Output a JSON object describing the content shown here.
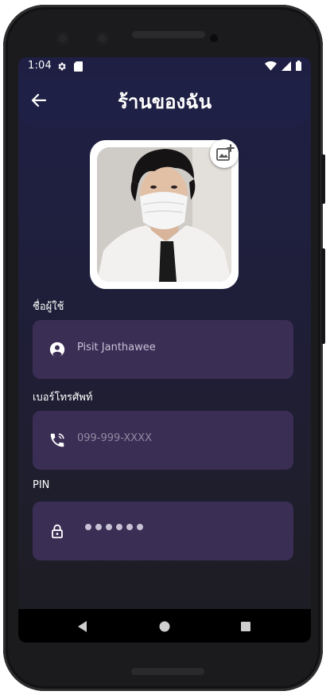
{
  "status_bar": {
    "time": "1:04",
    "icons": [
      "settings-icon",
      "sd-card-icon",
      "wifi-icon",
      "signal-icon",
      "battery-icon"
    ]
  },
  "app_bar": {
    "title": "ร้านของฉัน",
    "back_icon": "arrow-left-icon"
  },
  "profile": {
    "avatar": "profile-photo",
    "add_photo_icon": "add-photo-icon"
  },
  "form": {
    "username": {
      "label": "ชื่อผู้ใช้",
      "value": "Pisit Janthawee",
      "icon": "account-circle-icon"
    },
    "phone": {
      "label": "เบอร์โทรศัพท์",
      "placeholder": "099-999-XXXX",
      "icon": "phone-icon"
    },
    "pin": {
      "label": "PIN",
      "masked_length": 6,
      "icon": "lock-icon"
    }
  },
  "nav_bar": {
    "items": [
      "back-triangle-icon",
      "home-circle-icon",
      "recents-square-icon"
    ]
  },
  "colors": {
    "app_bar": "#1f2045",
    "field_bg": "#3b2e55",
    "text": "#ffffff",
    "placeholder": "#8e8aa0"
  }
}
